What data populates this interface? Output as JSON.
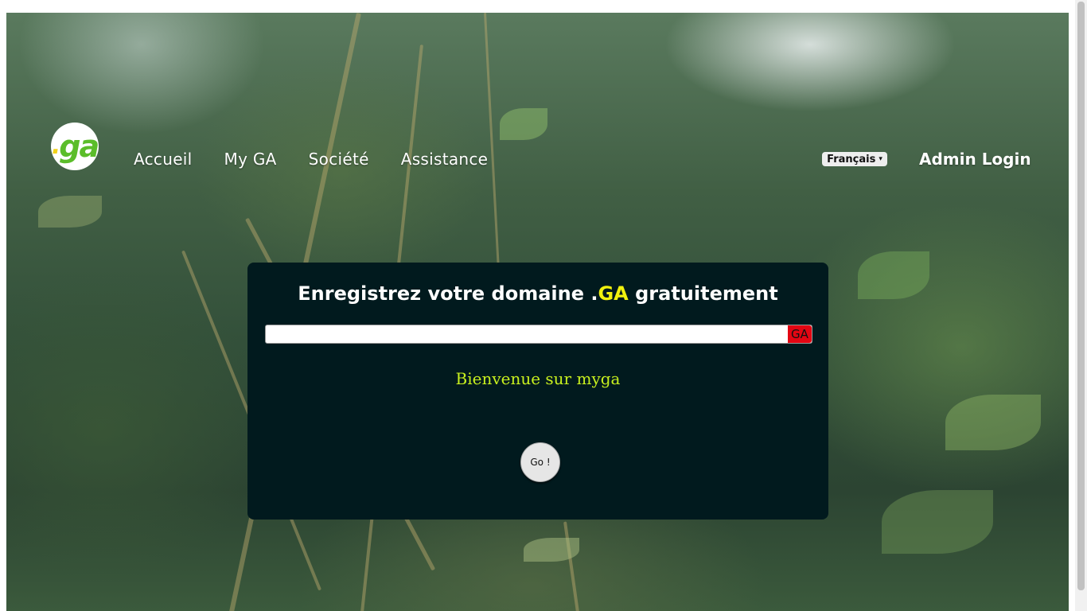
{
  "header": {
    "logo_text": "ga",
    "logo_dot": ".",
    "nav": [
      {
        "label": "Accueil"
      },
      {
        "label": "My GA"
      },
      {
        "label": "Société"
      },
      {
        "label": "Assistance"
      }
    ],
    "language": {
      "selected": "Français",
      "caret": "▾"
    },
    "admin_login": "Admin Login"
  },
  "main": {
    "title_prefix": "Enregistrez votre domaine .",
    "title_tld": "GA",
    "title_suffix": " gratuitement",
    "domain_input": {
      "value": "",
      "placeholder": ""
    },
    "tld_badge": "GA",
    "welcome": "Bienvenue sur myga",
    "go_label": "Go !"
  },
  "colors": {
    "card_bg": "#011a1e",
    "tld_highlight": "#f1f10e",
    "welcome_text": "#c8f01e",
    "tld_badge_bg": "#e30613",
    "logo_green": "#5bbd2a"
  }
}
